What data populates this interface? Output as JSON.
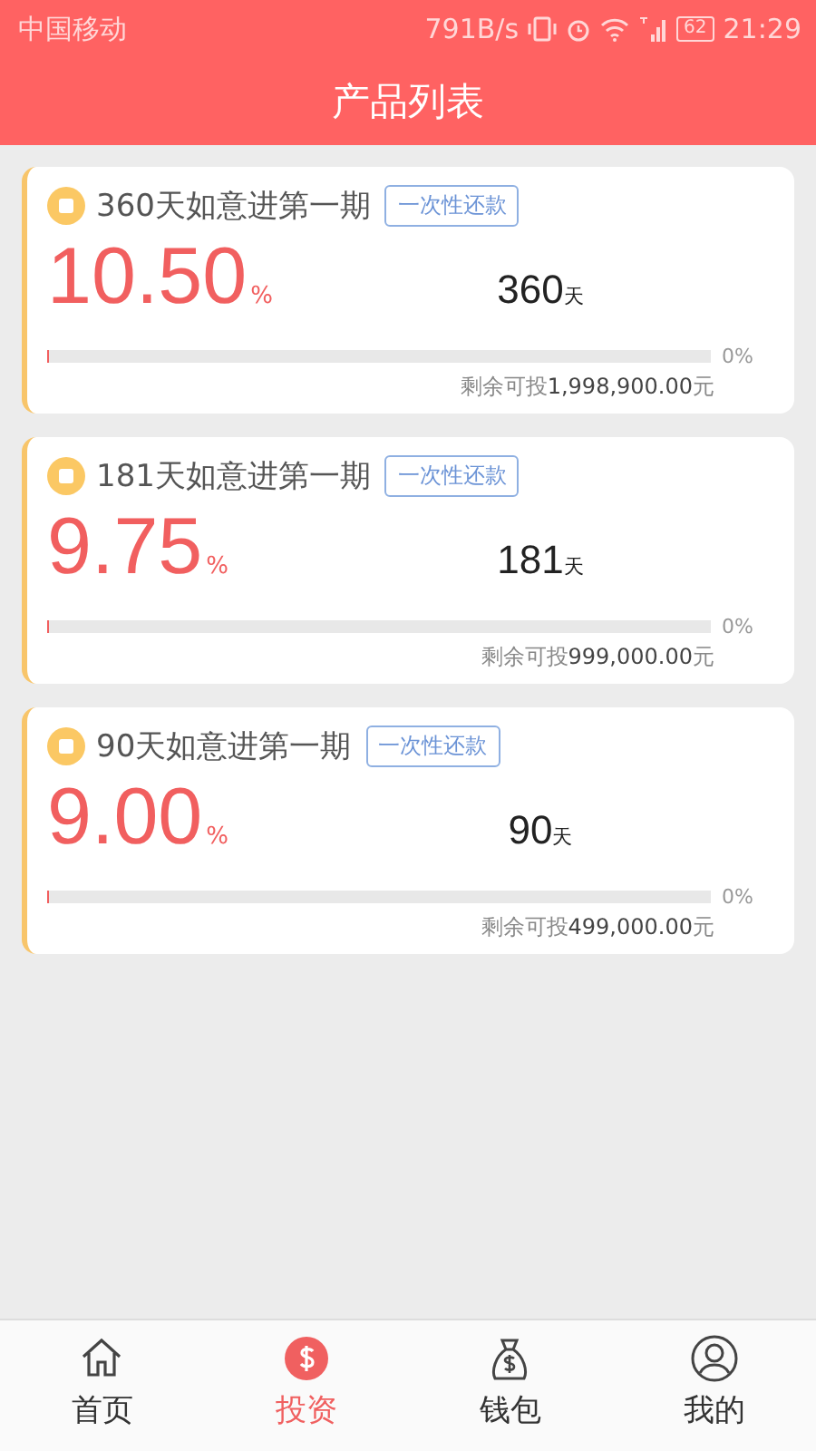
{
  "status_bar": {
    "carrier": "中国移动",
    "speed": "791B/s",
    "battery": "62",
    "time": "21:29"
  },
  "header": {
    "title": "产品列表"
  },
  "products": [
    {
      "name": "360天如意进第一期",
      "tag": "一次性还款",
      "rate": "10.50",
      "rate_unit": "%",
      "days": "360",
      "days_unit": "天",
      "level": 0,
      "progress": "0%",
      "remaining_label": "剩余可投",
      "remaining_amount": "1,998,900.00",
      "remaining_unit": "元"
    },
    {
      "name": "181天如意进第一期",
      "tag": "一次性还款",
      "rate": "9.75",
      "rate_unit": "%",
      "days": "181",
      "days_unit": "天",
      "level": 0,
      "progress": "0%",
      "remaining_label": "剩余可投",
      "remaining_amount": "999,000.00",
      "remaining_unit": "元"
    },
    {
      "name": "90天如意进第一期",
      "tag": "一次性还款",
      "rate": "9.00",
      "rate_unit": "%",
      "days": "90",
      "days_unit": "天",
      "level": 0,
      "progress": "0%",
      "remaining_label": "剩余可投",
      "remaining_amount": "499,000.00",
      "remaining_unit": "元"
    }
  ],
  "tabs": [
    {
      "label": "首页",
      "kind": "home",
      "selected": false
    },
    {
      "label": "投资",
      "kind": "dollar",
      "selected": true
    },
    {
      "label": "钱包",
      "kind": "bag",
      "selected": false
    },
    {
      "label": "我的",
      "kind": "user",
      "selected": false
    }
  ]
}
